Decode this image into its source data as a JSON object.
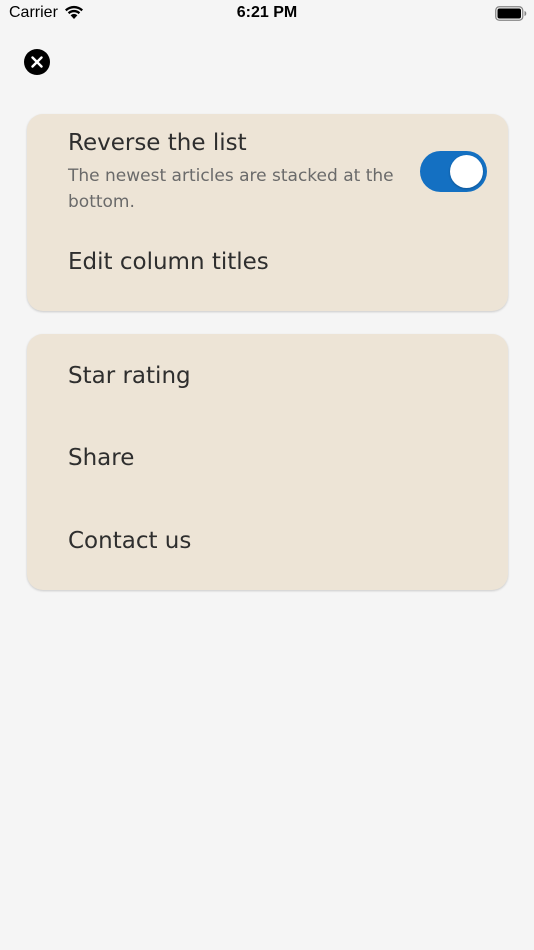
{
  "status_bar": {
    "carrier": "Carrier",
    "time": "6:21 PM",
    "wifi_icon": "wifi-icon",
    "battery_icon": "battery-icon"
  },
  "close_button": {
    "icon": "close-icon"
  },
  "settings_card": {
    "reverse_list": {
      "title": "Reverse the list",
      "subtitle": "The newest articles are stacked at the bottom.",
      "toggle_on": true
    },
    "edit_column_titles": {
      "title": "Edit column titles"
    }
  },
  "links_card": {
    "items": [
      {
        "title": "Star rating"
      },
      {
        "title": "Share"
      },
      {
        "title": "Contact us"
      }
    ]
  },
  "colors": {
    "background": "#f5f5f5",
    "card": "#ede4d6",
    "toggle_on": "#1470c2",
    "text_primary": "#2e2e2e",
    "text_secondary": "#6a6a6a"
  }
}
